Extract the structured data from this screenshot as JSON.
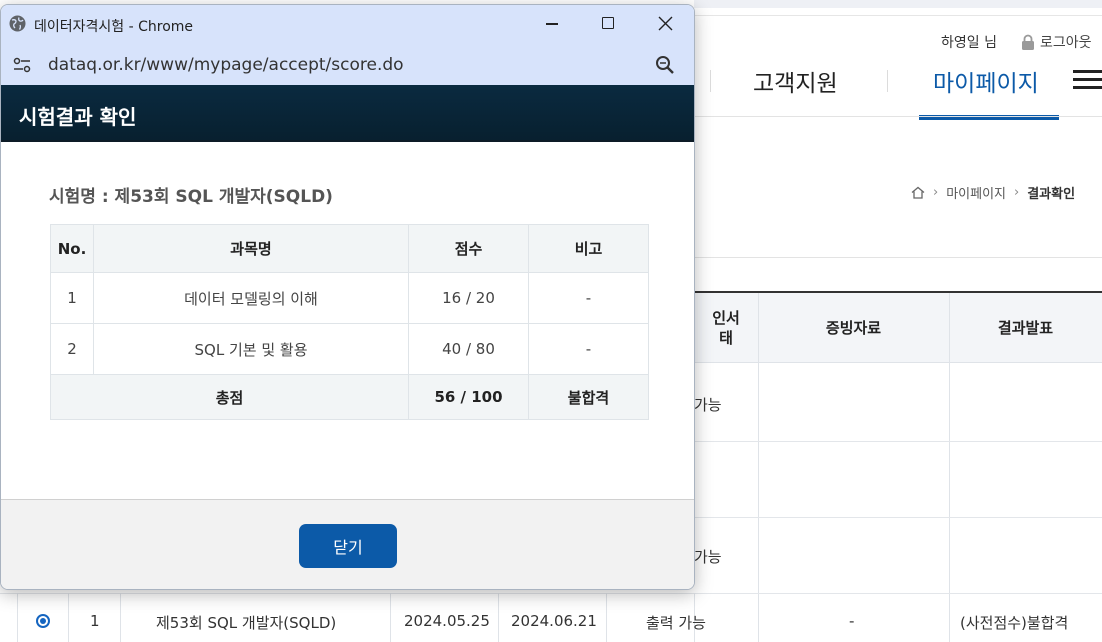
{
  "background_page": {
    "user_greeting": "하영일 님",
    "logout_label": "로그아웃",
    "nav": {
      "customer_support": "고객지원",
      "my_page": "마이페이지"
    },
    "breadcrumb": {
      "item1": "마이페이지",
      "item2": "결과확인"
    },
    "table": {
      "headers": {
        "cert_status_line1": "인서",
        "cert_status_line2": "태",
        "evidence": "증빙자료",
        "result": "결과발표"
      },
      "partial_rows": [
        "가능",
        "가능"
      ],
      "selected_row": {
        "no": "1",
        "exam_name": "제53회 SQL 개발자(SQLD)",
        "exam_date": "2024.05.25",
        "announce_date": "2024.06.21",
        "cert_status": "출력 가능",
        "evidence": "-",
        "result": "(사전점수)불합격"
      }
    }
  },
  "window": {
    "title": "데이터자격시험 - Chrome",
    "url": "dataq.or.kr/www/mypage/accept/score.do"
  },
  "popup": {
    "title": "시험결과 확인",
    "exam_name": "시험명 : 제53회 SQL 개발자(SQLD)",
    "table": {
      "headers": [
        "No.",
        "과목명",
        "점수",
        "비고"
      ],
      "rows": [
        {
          "no": "1",
          "subject": "데이터 모델링의 이해",
          "score": "16 / 20",
          "note": "-"
        },
        {
          "no": "2",
          "subject": "SQL 기본 및 활용",
          "score": "40 / 80",
          "note": "-"
        }
      ],
      "total": {
        "label": "총점",
        "score": "56 / 100",
        "result": "불합격"
      }
    },
    "close_label": "닫기"
  },
  "colors": {
    "accent": "#0c5aa8",
    "titlebar": "#d7e3fb",
    "popup_header": "#0a2a40"
  }
}
